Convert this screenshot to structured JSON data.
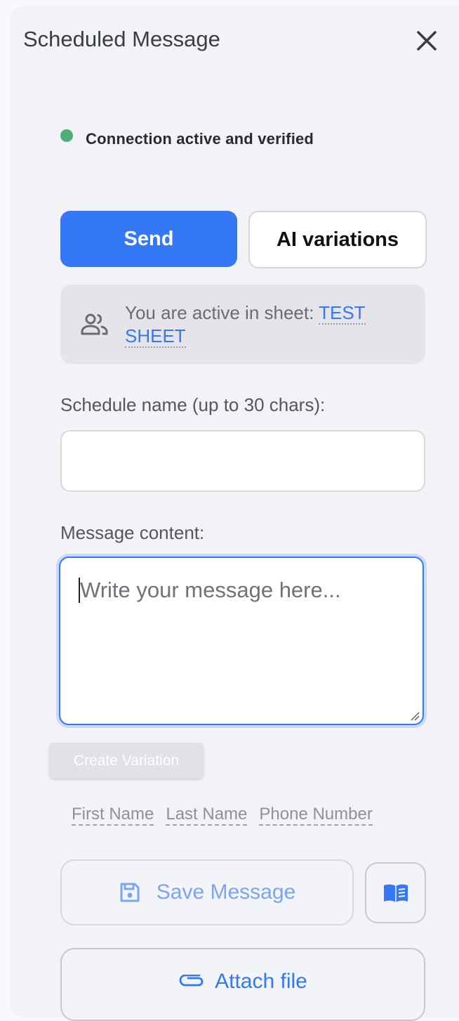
{
  "header": {
    "title": "Scheduled Message",
    "close_icon": "close-icon"
  },
  "status": {
    "text": "Connection active and verified",
    "color": "#4caf7d"
  },
  "actions": {
    "send_label": "Send",
    "ai_variations_label": "AI variations"
  },
  "sheet": {
    "prefix": "You are active in sheet: ",
    "name": "TEST SHEET",
    "icon": "users-icon"
  },
  "form": {
    "schedule_name_label": "Schedule name (up to 30 chars):",
    "schedule_name_value": "",
    "message_label": "Message content:",
    "message_placeholder": "Write your message here...",
    "message_value": ""
  },
  "variation": {
    "create_label": "Create Variation"
  },
  "variables": [
    "First Name",
    "Last Name",
    "Phone Number"
  ],
  "footer": {
    "save_label": "Save Message",
    "save_icon": "floppy-disk-icon",
    "library_icon": "book-icon",
    "attach_label": "Attach file",
    "attach_icon": "paperclip-icon"
  },
  "colors": {
    "accent": "#3478f6",
    "panel": "#f1f3f8"
  }
}
